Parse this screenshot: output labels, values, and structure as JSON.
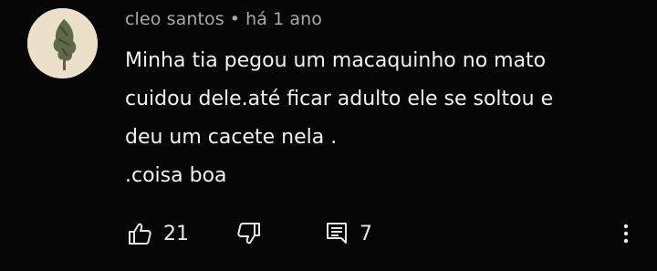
{
  "comment": {
    "author": "cleo santos",
    "separator": "•",
    "timestamp": "há 1 ano",
    "lines": [
      "Minha tia pegou um macaquinho no mato",
      "cuidou dele.até ficar adulto ele se soltou e",
      "deu um cacete nela .",
      ".coisa boa"
    ],
    "likes": "21",
    "replies": "7"
  },
  "icons": {
    "like": "thumbs-up-icon",
    "dislike": "thumbs-down-icon",
    "reply": "comment-icon",
    "more": "more-vertical-icon"
  },
  "colors": {
    "background": "#060606",
    "author": "#a9a9a9",
    "text": "#f1f1f1"
  }
}
